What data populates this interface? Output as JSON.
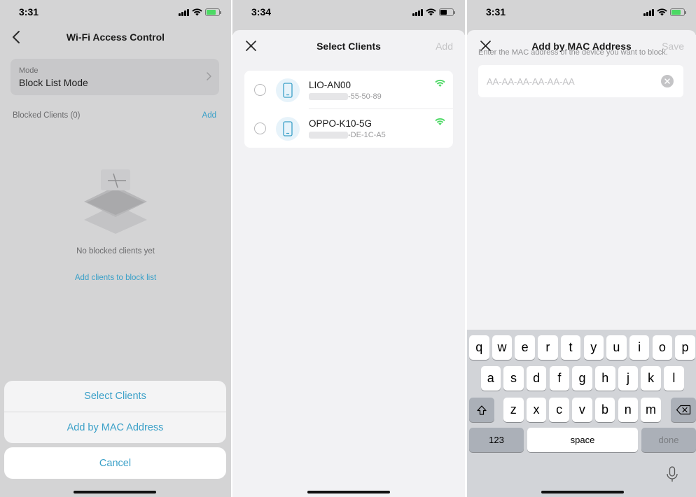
{
  "screen1": {
    "status": {
      "time": "3:31"
    },
    "nav": {
      "title": "Wi-Fi Access Control"
    },
    "mode": {
      "label": "Mode",
      "value": "Block List Mode"
    },
    "blocked_header": "Blocked Clients (0)",
    "add_label": "Add",
    "empty_text": "No blocked clients yet",
    "empty_link": "Add clients to block list",
    "action_sheet": {
      "options": [
        "Select Clients",
        "Add by MAC Address"
      ],
      "cancel": "Cancel"
    }
  },
  "screen2": {
    "status": {
      "time": "3:34"
    },
    "title": "Select Clients",
    "action": "Add",
    "clients": [
      {
        "name": "LIO-AN00",
        "mac_visible": "-55-50-89"
      },
      {
        "name": "OPPO-K10-5G",
        "mac_visible": "-DE-1C-A5"
      }
    ]
  },
  "screen3": {
    "status": {
      "time": "3:31"
    },
    "title": "Add by MAC Address",
    "action": "Save",
    "hint": "Enter the MAC address of the device you want to block.",
    "input_placeholder": "AA-AA-AA-AA-AA-AA",
    "keyboard": {
      "row1": [
        "q",
        "w",
        "e",
        "r",
        "t",
        "y",
        "u",
        "i",
        "o",
        "p"
      ],
      "row2": [
        "a",
        "s",
        "d",
        "f",
        "g",
        "h",
        "j",
        "k",
        "l"
      ],
      "row3": [
        "z",
        "x",
        "c",
        "v",
        "b",
        "n",
        "m"
      ],
      "numbers": "123",
      "space": "space",
      "done": "done"
    }
  },
  "colors": {
    "accent": "#3aa0c8",
    "wifi_green": "#4cd964",
    "battery_charging": "#4cd964"
  }
}
